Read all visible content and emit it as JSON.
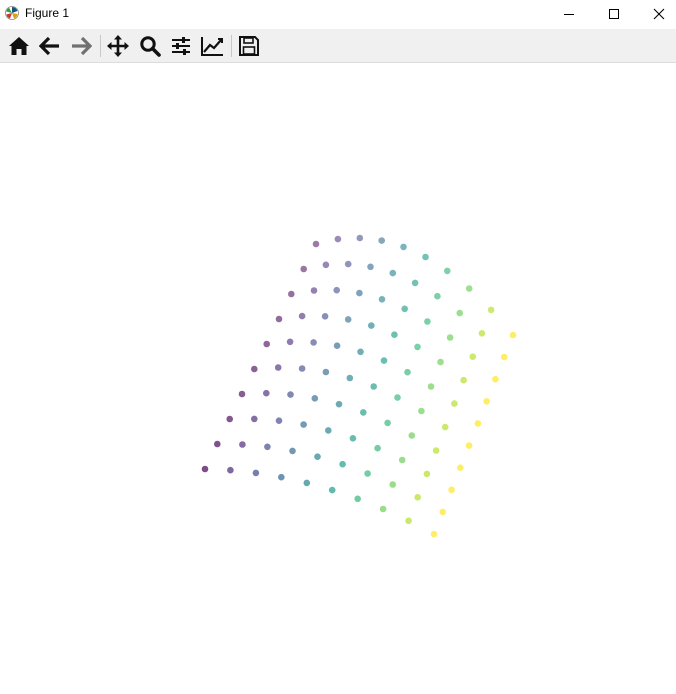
{
  "window": {
    "title": "Figure 1",
    "controls": [
      "minimize",
      "maximize",
      "close"
    ]
  },
  "toolbar": {
    "buttons": [
      {
        "name": "home",
        "icon": "home-icon"
      },
      {
        "name": "back",
        "icon": "arrow-left-icon"
      },
      {
        "name": "forward",
        "icon": "arrow-right-icon"
      },
      {
        "name": "pan",
        "icon": "move-icon"
      },
      {
        "name": "zoom",
        "icon": "magnifier-icon"
      },
      {
        "name": "configure-subplots",
        "icon": "sliders-icon"
      },
      {
        "name": "edit-axes",
        "icon": "line-chart-icon"
      },
      {
        "name": "save",
        "icon": "floppy-disk-icon"
      }
    ]
  },
  "chart_data": {
    "type": "scatter",
    "projection": "3d",
    "title": "",
    "xlabel": "",
    "ylabel": "",
    "zlabel": "",
    "axes_visible": false,
    "grid": false,
    "colormap": "viridis",
    "point_alpha": 0.7,
    "grid_shape": [
      10,
      10
    ],
    "u": [
      0,
      0.1111,
      0.2222,
      0.3333,
      0.4444,
      0.5556,
      0.6667,
      0.7778,
      0.8889,
      1
    ],
    "v": [
      0,
      0.1111,
      0.2222,
      0.3333,
      0.4444,
      0.5556,
      0.6667,
      0.7778,
      0.8889,
      1
    ],
    "color_by": "u",
    "color_stops": [
      "#440154",
      "#482878",
      "#3e4989",
      "#31688e",
      "#26828e",
      "#1f9e89",
      "#35b779",
      "#6ece58",
      "#b5de2b",
      "#fde725"
    ]
  }
}
